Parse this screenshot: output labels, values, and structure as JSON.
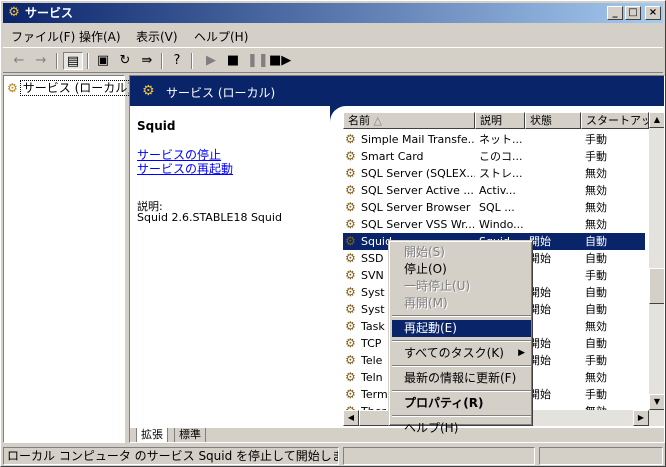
{
  "window": {
    "title": "サービス"
  },
  "menu": [
    "ファイル(F)",
    "操作(A)",
    "表示(V)",
    "ヘルプ(H)"
  ],
  "tree": {
    "root": "サービス (ローカル)"
  },
  "panel": {
    "header": "サービス (ローカル)",
    "selected_service": "Squid",
    "links": [
      "サービスの停止",
      "サービスの再起動"
    ],
    "description_label": "説明:",
    "description_value": "Squid 2.6.STABLE18 Squid"
  },
  "columns": [
    "名前",
    "説明",
    "状態",
    "スタートアップ"
  ],
  "rows": [
    {
      "name": "Simple Mail Transfe...",
      "desc": "ネット...",
      "state": "",
      "startup": "手動"
    },
    {
      "name": "Smart Card",
      "desc": "このコ...",
      "state": "",
      "startup": "手動"
    },
    {
      "name": "SQL Server (SQLEX...",
      "desc": "ストレ...",
      "state": "",
      "startup": "無効"
    },
    {
      "name": "SQL Server Active ...",
      "desc": "Activ...",
      "state": "",
      "startup": "無効"
    },
    {
      "name": "SQL Server Browser",
      "desc": "SQL ...",
      "state": "",
      "startup": "無効"
    },
    {
      "name": "SQL Server VSS Wr...",
      "desc": "Windo...",
      "state": "",
      "startup": "無効"
    },
    {
      "name": "Squid",
      "desc": "Squid",
      "state": "開始",
      "startup": "自動"
    },
    {
      "name": "SSD",
      "desc": "",
      "state": "開始",
      "startup": "自動"
    },
    {
      "name": "SVN",
      "desc": "",
      "state": "",
      "startup": "手動"
    },
    {
      "name": "Syst",
      "desc": "",
      "state": "開始",
      "startup": "自動"
    },
    {
      "name": "Syst",
      "desc": "",
      "state": "開始",
      "startup": "自動"
    },
    {
      "name": "Task",
      "desc": "",
      "state": "",
      "startup": "無効"
    },
    {
      "name": "TCP",
      "desc": "",
      "state": "開始",
      "startup": "自動"
    },
    {
      "name": "Tele",
      "desc": "",
      "state": "開始",
      "startup": "手動"
    },
    {
      "name": "Teln",
      "desc": "",
      "state": "",
      "startup": "無効"
    },
    {
      "name": "Term",
      "desc": "",
      "state": "開始",
      "startup": "手動"
    },
    {
      "name": "Ther",
      "desc": "",
      "state": "",
      "startup": "無効"
    }
  ],
  "context_menu": [
    {
      "label": "開始(S)",
      "state": "disabled"
    },
    {
      "label": "停止(O)",
      "state": "normal"
    },
    {
      "label": "一時停止(U)",
      "state": "disabled"
    },
    {
      "label": "再開(M)",
      "state": "disabled"
    },
    {
      "label": "再起動(E)",
      "state": "highlighted"
    },
    {
      "label": "すべてのタスク(K)",
      "state": "submenu"
    },
    {
      "label": "最新の情報に更新(F)",
      "state": "normal"
    },
    {
      "label": "プロパティ(R)",
      "state": "bold"
    },
    {
      "label": "ヘルプ(H)",
      "state": "normal"
    }
  ],
  "tabs": [
    "拡張",
    "標準"
  ],
  "status_text": "ローカル コンピュータ のサービス Squid を停止して開始します。"
}
